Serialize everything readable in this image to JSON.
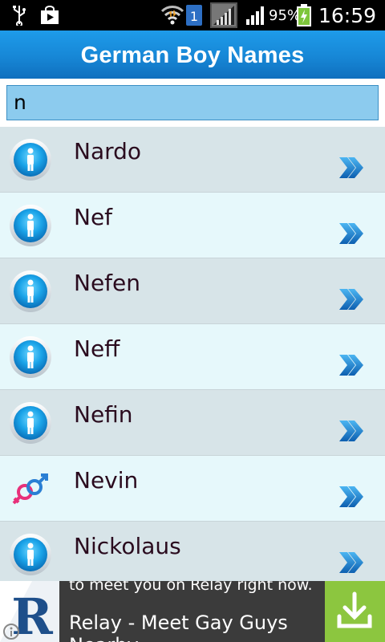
{
  "status_bar": {
    "battery_percent": "95%",
    "time": "16:59",
    "sim_badge": "1",
    "icons": [
      "usb-icon",
      "shopping-bag-icon",
      "wifi-icon",
      "sim-icon",
      "signal-icon",
      "signal-icon",
      "battery-charging-icon"
    ]
  },
  "header": {
    "title": "German Boy Names"
  },
  "search": {
    "value": "n"
  },
  "list": {
    "items": [
      {
        "label": "Nardo",
        "icon": "male-icon"
      },
      {
        "label": "Nef",
        "icon": "male-icon"
      },
      {
        "label": "Nefen",
        "icon": "male-icon"
      },
      {
        "label": "Neff",
        "icon": "male-icon"
      },
      {
        "label": "Nefin",
        "icon": "male-icon"
      },
      {
        "label": "Nevin",
        "icon": "unisex-icon"
      },
      {
        "label": "Nickolaus",
        "icon": "male-icon"
      }
    ]
  },
  "ad": {
    "line1": "to meet you on Relay right now.",
    "line2": "Relay - Meet Gay Guys",
    "line3": "Nearby",
    "logo_letter": "R"
  },
  "colors": {
    "title_bar": "#1787d6",
    "search_field": "#8ccbee",
    "row_alt": "#d7e4e8",
    "row": "#e6f8fb",
    "chevron": "#1a7fd0",
    "ad_download": "#8cc63f"
  }
}
